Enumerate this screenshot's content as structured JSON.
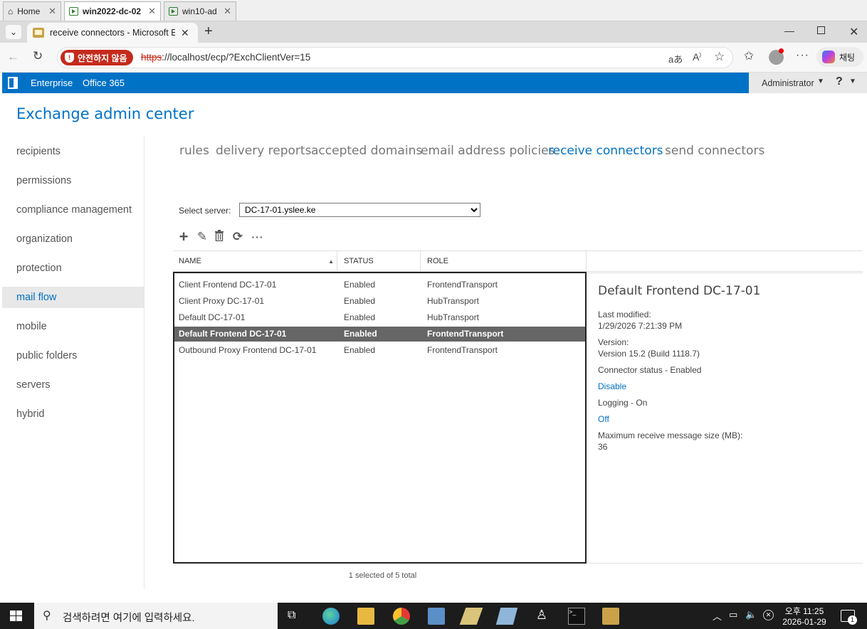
{
  "host_tabs": [
    {
      "label": "Home"
    },
    {
      "label": "win2022-dc-02"
    },
    {
      "label": "win10-ad"
    }
  ],
  "browser": {
    "tab_title": "receive connectors - Microsoft Exchange",
    "security_label": "안전하지 않음",
    "url_scheme": "https",
    "url_rest": "://localhost/ecp/?ExchClientVer=15",
    "profile_label": "채팅"
  },
  "ecp": {
    "top_links": {
      "enterprise": "Enterprise",
      "office365": "Office 365"
    },
    "user": "Administrator",
    "help": "?",
    "title": "Exchange admin center"
  },
  "nav": [
    {
      "label": "recipients"
    },
    {
      "label": "permissions"
    },
    {
      "label": "compliance management"
    },
    {
      "label": "organization"
    },
    {
      "label": "protection"
    },
    {
      "label": "mail flow",
      "active": true
    },
    {
      "label": "mobile"
    },
    {
      "label": "public folders"
    },
    {
      "label": "servers"
    },
    {
      "label": "hybrid"
    }
  ],
  "subtabs": [
    {
      "label": "rules"
    },
    {
      "label": "delivery reports"
    },
    {
      "label": "accepted domains"
    },
    {
      "label": "email address policies"
    },
    {
      "label": "receive connectors",
      "active": true
    },
    {
      "label": "send connectors"
    }
  ],
  "server": {
    "label": "Select server:",
    "value": "DC-17-01.yslee.ke"
  },
  "grid": {
    "columns": {
      "name": "NAME",
      "status": "STATUS",
      "role": "ROLE"
    },
    "rows": [
      {
        "name": "Client Frontend DC-17-01",
        "status": "Enabled",
        "role": "FrontendTransport"
      },
      {
        "name": "Client Proxy DC-17-01",
        "status": "Enabled",
        "role": "HubTransport"
      },
      {
        "name": "Default DC-17-01",
        "status": "Enabled",
        "role": "HubTransport"
      },
      {
        "name": "Default Frontend DC-17-01",
        "status": "Enabled",
        "role": "FrontendTransport",
        "selected": true
      },
      {
        "name": "Outbound Proxy Frontend DC-17-01",
        "status": "Enabled",
        "role": "FrontendTransport"
      }
    ],
    "footer": "1 selected of 5 total"
  },
  "details": {
    "title": "Default Frontend DC-17-01",
    "last_modified_label": "Last modified:",
    "last_modified": "1/29/2026 7:21:39 PM",
    "version_label": "Version:",
    "version": "Version 15.2 (Build 1118.7)",
    "connector_status": "Connector status - Enabled",
    "disable_link": "Disable",
    "logging": "Logging - On",
    "off_link": "Off",
    "max_size_label": "Maximum receive message size (MB):",
    "max_size": "36"
  },
  "taskbar": {
    "search_placeholder": "검색하려면 여기에 입력하세요.",
    "time": "오후 11:25",
    "date": "2026-01-29",
    "notification_count": "1"
  },
  "colors": {
    "accent": "#0072c6",
    "selected_row": "#666666",
    "unsafe": "#c42b1c"
  }
}
